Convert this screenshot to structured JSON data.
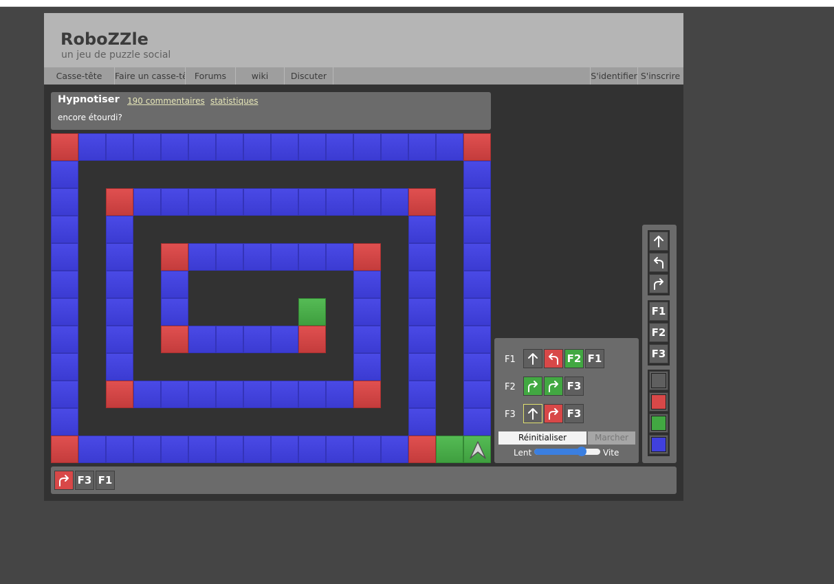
{
  "site": {
    "title": "RoboZZle",
    "subtitle": "un jeu de puzzle social"
  },
  "nav": {
    "left": [
      "Casse-tête",
      "Faire un casse-tête",
      "Forums",
      "wiki",
      "Discuter"
    ],
    "right": [
      "S'identifier",
      "S'inscrire"
    ]
  },
  "puzzle": {
    "name": "Hypnotiser",
    "comments": "190 commentaires",
    "stats": "statistiques",
    "description": "encore étourdi?"
  },
  "board": {
    "grid": [
      "RBBBBBBBBBBBBBBR",
      "B..............B",
      "B.RBBBBBBBBBBR.B",
      "B.B..........B.B",
      "B.B.RBBBBBBR.B.B",
      "B.B.B......B.B.B",
      "B.B.B....G.B.B.B",
      "B.B.RBBBBR.B.B.B",
      "B.B........B.B.B",
      "B.RBBBBBBBBR.B.B",
      "B............B.B",
      "RBBBBBBBBBBBBRG."
    ],
    "robot": {
      "row": 11,
      "col": 15,
      "color": "G",
      "facing": "up"
    }
  },
  "colors": {
    "gray": "#5f5f5f",
    "red": "#d84848",
    "green": "#42a842",
    "blue": "#4040dd"
  },
  "program": {
    "functions": [
      {
        "label": "F1",
        "slots": [
          {
            "op": "forward",
            "color": "gray",
            "icon": "up-arrow-icon"
          },
          {
            "op": "left",
            "color": "red",
            "icon": "turn-left-icon"
          },
          {
            "op": "call",
            "text": "F2",
            "color": "green"
          },
          {
            "op": "call",
            "text": "F1",
            "color": "gray"
          }
        ]
      },
      {
        "label": "F2",
        "slots": [
          {
            "op": "right",
            "color": "green",
            "icon": "turn-right-icon"
          },
          {
            "op": "right",
            "color": "green",
            "icon": "turn-right-icon"
          },
          {
            "op": "call",
            "text": "F3",
            "color": "gray"
          }
        ]
      },
      {
        "label": "F3",
        "slots": [
          {
            "op": "forward",
            "color": "gray",
            "icon": "up-arrow-icon",
            "selected": true
          },
          {
            "op": "right",
            "color": "red",
            "icon": "turn-right-icon"
          },
          {
            "op": "call",
            "text": "F3",
            "color": "gray"
          }
        ]
      }
    ],
    "reset_label": "Réinitialiser",
    "step_label": "Marcher",
    "speed_slow": "Lent",
    "speed_fast": "Vite",
    "speed_value": 0.72
  },
  "palette": {
    "moves": [
      "forward",
      "left",
      "right"
    ],
    "functions": [
      "F1",
      "F2",
      "F3"
    ],
    "colors": [
      "gray",
      "red",
      "green",
      "blue"
    ]
  },
  "stack": [
    {
      "op": "right",
      "color": "red",
      "icon": "turn-right-icon"
    },
    {
      "op": "call",
      "text": "F3",
      "color": "gray"
    },
    {
      "op": "call",
      "text": "F1",
      "color": "gray"
    }
  ]
}
